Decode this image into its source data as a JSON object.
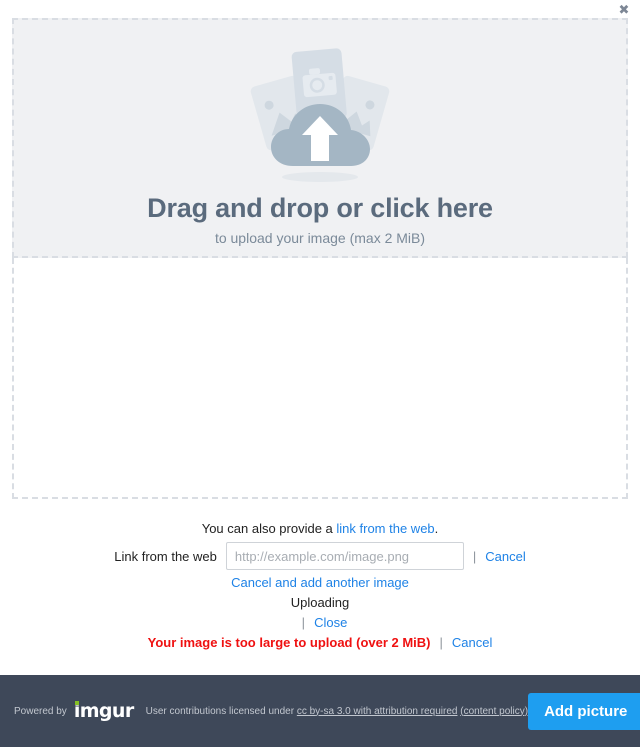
{
  "dialog": {
    "close_label": "✖"
  },
  "dropzone": {
    "title": "Drag and drop or click here",
    "subtitle": "to upload your image (max 2 MiB)",
    "illustration_name": "cloud-upload-photos-illustration"
  },
  "form": {
    "provide_prefix": "You can also provide a ",
    "provide_link": "link from the web",
    "provide_suffix": ".",
    "link_label": "Link from the web",
    "url_placeholder": "http://example.com/image.png",
    "url_value": "",
    "url_cancel": "Cancel",
    "separator": "|",
    "cancel_add_another": "Cancel and add another image",
    "status": "Uploading",
    "close": "Close",
    "error": "Your image is too large to upload (over 2 MiB)",
    "error_cancel": "Cancel"
  },
  "footer": {
    "powered_by": "Powered by",
    "brand": "imgur",
    "license_prefix": "User contributions licensed under ",
    "license_link": "cc by-sa 3.0 with attribution required",
    "content_policy": "(content policy)",
    "add_picture": "Add picture"
  },
  "colors": {
    "accent_blue": "#1e82e6",
    "button_blue": "#1e9ef0",
    "error_red": "#ef1111",
    "footer_bg": "#3e4859",
    "dropzone_bg": "#f0f1f3",
    "dashed_border": "#d9dde3",
    "brand_green": "#85bf25"
  }
}
